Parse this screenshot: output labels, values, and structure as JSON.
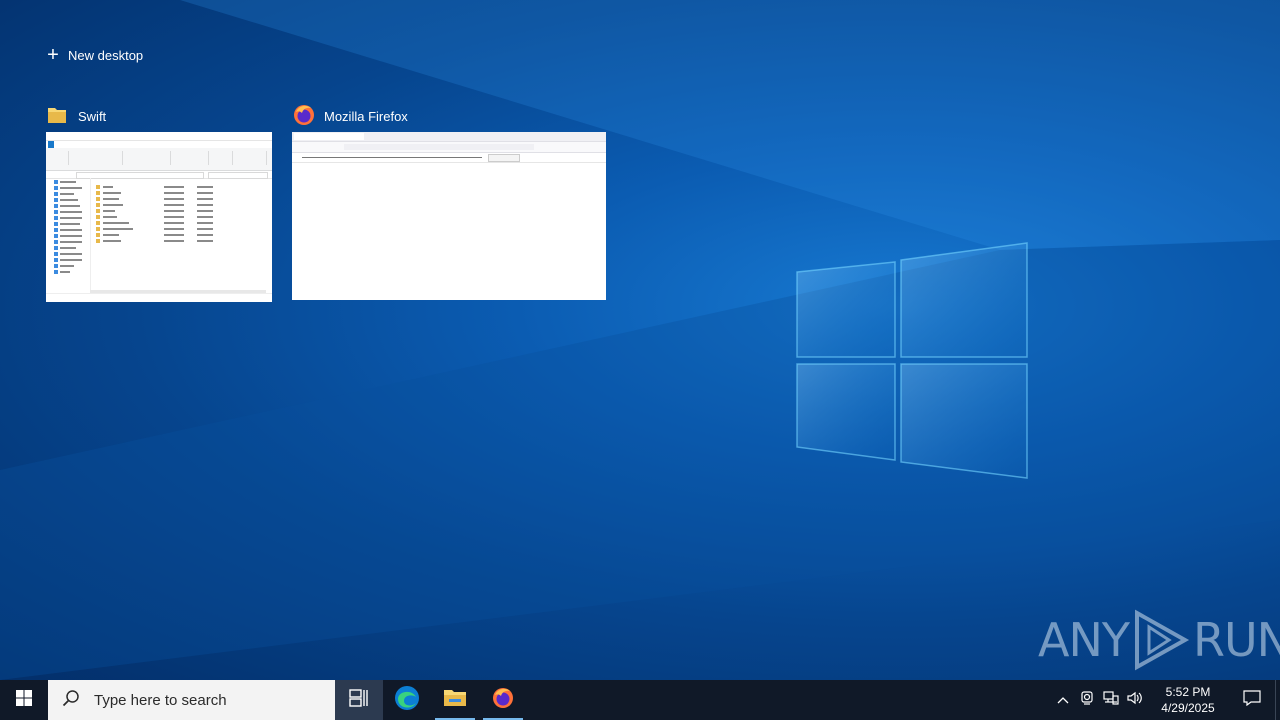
{
  "task_view": {
    "new_desktop_label": "New desktop",
    "windows": [
      {
        "title": "Swift",
        "icon": "folder-icon"
      },
      {
        "title": "Mozilla Firefox",
        "icon": "firefox-icon"
      }
    ]
  },
  "watermark": {
    "left": "ANY",
    "right": "RUN"
  },
  "taskbar": {
    "search_placeholder": "Type here to search",
    "pinned": [
      "start-icon",
      "task-view-icon",
      "edge-icon",
      "file-explorer-icon",
      "firefox-icon"
    ],
    "clock": {
      "time": "5:52 PM",
      "date": "4/29/2025"
    },
    "tray_icons": [
      "chevron-up-icon",
      "meet-now-icon",
      "network-icon",
      "volume-icon",
      "notification-icon"
    ]
  },
  "colors": {
    "desktop": "#0b5cb2",
    "taskbar": "#101928",
    "accent": "#76b9ed"
  }
}
